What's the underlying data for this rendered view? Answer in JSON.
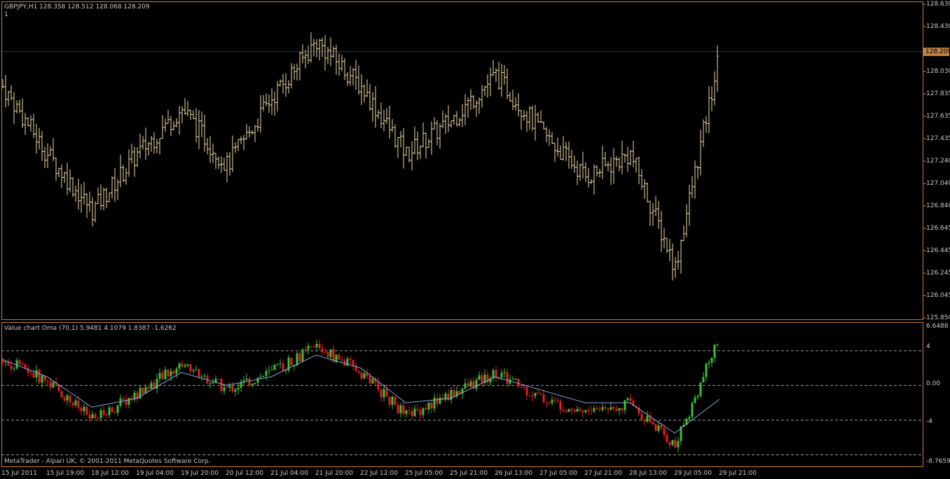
{
  "window": {
    "symbol_header": "GBPJPY,H1  128.358 128.512 128.068 128.209",
    "window_index": "1",
    "copyright": "MetaTrader - Alpari UK, © 2001-2011 MetaQuotes Software Corp."
  },
  "colors": {
    "background": "#000000",
    "frame": "#c08040",
    "price_bars": "#f0d8a8",
    "bid_line": "#2a2a9a",
    "bull_candle": "#3cbf3c",
    "bear_candle": "#e02020",
    "signal_line": "#7aa6e0",
    "level_line": "#a0a0a0"
  },
  "price_panel": {
    "last_price_tag": "128.209",
    "price_ticks": [
      "128.630",
      "128.430",
      "128.209",
      "128.030",
      "127.835",
      "127.635",
      "127.435",
      "127.240",
      "127.040",
      "126.840",
      "126.645",
      "126.445",
      "126.245",
      "126.045",
      "125.850"
    ]
  },
  "indicator_panel": {
    "title": "Value chart Oma (70,1) 5.9481 4.1079 1.8387 -1.6262",
    "ticks": [
      "6.6488",
      "4",
      "0.00",
      "-4",
      "-8.7659"
    ],
    "levels": [
      4,
      0,
      -4,
      -8
    ]
  },
  "time_axis": [
    "15 Jul 2011",
    "15 Jul 19:00",
    "18 Jul 12:00",
    "19 Jul 04:00",
    "19 Jul 20:00",
    "20 Jul 12:00",
    "21 Jul 04:00",
    "21 Jul 20:00",
    "22 Jul 12:00",
    "25 Jul 05:00",
    "25 Jul 21:00",
    "26 Jul 13:00",
    "27 Jul 05:00",
    "27 Jul 21:00",
    "28 Jul 13:00",
    "29 Jul 05:00",
    "29 Jul 21:00"
  ],
  "chart_data": [
    {
      "type": "line",
      "title": "GBPJPY,H1",
      "ylim": [
        125.85,
        128.63
      ],
      "x": [
        "15 Jul 2011",
        "15 Jul 19:00",
        "18 Jul 12:00",
        "19 Jul 04:00",
        "19 Jul 20:00",
        "20 Jul 12:00",
        "21 Jul 04:00",
        "21 Jul 20:00",
        "22 Jul 12:00",
        "25 Jul 05:00",
        "25 Jul 21:00",
        "26 Jul 13:00",
        "27 Jul 05:00",
        "27 Jul 21:00",
        "28 Jul 13:00",
        "29 Jul 05:00",
        "29 Jul 21:00"
      ],
      "series": [
        {
          "name": "Close",
          "values": [
            127.9,
            127.3,
            126.8,
            127.3,
            127.7,
            127.2,
            127.8,
            128.3,
            127.9,
            127.3,
            127.6,
            128.0,
            127.5,
            127.1,
            127.3,
            126.3,
            128.21
          ]
        }
      ]
    },
    {
      "type": "line",
      "title": "Value chart Oma (70,1)",
      "ylim": [
        -8.7659,
        6.6488
      ],
      "x": [
        "15 Jul 2011",
        "15 Jul 19:00",
        "18 Jul 12:00",
        "19 Jul 04:00",
        "19 Jul 20:00",
        "20 Jul 12:00",
        "21 Jul 04:00",
        "21 Jul 20:00",
        "22 Jul 12:00",
        "25 Jul 05:00",
        "25 Jul 21:00",
        "26 Jul 13:00",
        "27 Jul 05:00",
        "27 Jul 21:00",
        "28 Jul 13:00",
        "29 Jul 05:00",
        "29 Jul 21:00"
      ],
      "series": [
        {
          "values": [
            3.0,
            0.5,
            -4.0,
            -1.0,
            2.5,
            -0.5,
            1.5,
            4.5,
            1.5,
            -3.5,
            -1.0,
            1.5,
            -1.5,
            -3.0,
            -2.0,
            -7.0,
            5.9
          ]
        },
        {
          "values": [
            3.0,
            1.0,
            -2.5,
            -1.5,
            1.5,
            0.0,
            1.0,
            3.5,
            2.0,
            -2.0,
            -1.5,
            1.0,
            -0.5,
            -2.0,
            -2.0,
            -5.5,
            -1.6
          ]
        }
      ]
    }
  ]
}
